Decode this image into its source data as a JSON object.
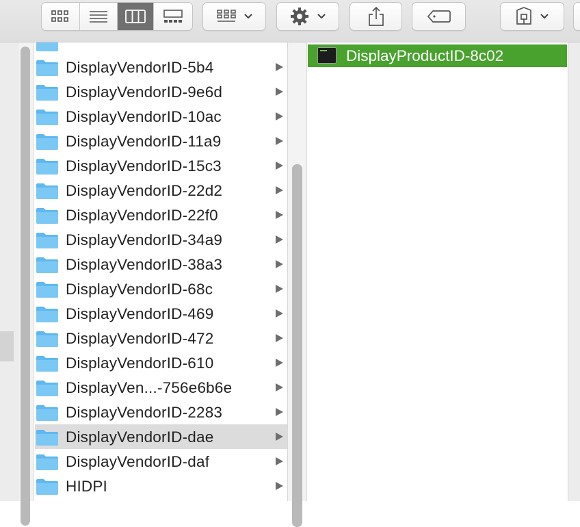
{
  "toolbar": {
    "view_modes": [
      {
        "name": "icon-view",
        "icon": "icon-grid-icon",
        "active": false
      },
      {
        "name": "list-view",
        "icon": "list-lines-icon",
        "active": false
      },
      {
        "name": "column-view",
        "icon": "columns-icon",
        "active": true
      },
      {
        "name": "gallery-view",
        "icon": "gallery-icon",
        "active": false
      }
    ],
    "group_by_icon": "group-grid-icon",
    "action_icon": "gear-icon",
    "share_icon": "share-icon",
    "tags_icon": "tag-icon",
    "dropbox_icon": "dropbox-icon"
  },
  "columns": {
    "folders": [
      {
        "label": "DisplayVendorID-5b4",
        "selected": false
      },
      {
        "label": "DisplayVendorID-9e6d",
        "selected": false
      },
      {
        "label": "DisplayVendorID-10ac",
        "selected": false
      },
      {
        "label": "DisplayVendorID-11a9",
        "selected": false
      },
      {
        "label": "DisplayVendorID-15c3",
        "selected": false
      },
      {
        "label": "DisplayVendorID-22d2",
        "selected": false
      },
      {
        "label": "DisplayVendorID-22f0",
        "selected": false
      },
      {
        "label": "DisplayVendorID-34a9",
        "selected": false
      },
      {
        "label": "DisplayVendorID-38a3",
        "selected": false
      },
      {
        "label": "DisplayVendorID-68c",
        "selected": false
      },
      {
        "label": "DisplayVendorID-469",
        "selected": false
      },
      {
        "label": "DisplayVendorID-472",
        "selected": false
      },
      {
        "label": "DisplayVendorID-610",
        "selected": false
      },
      {
        "label": "DisplayVen...-756e6b6e",
        "selected": false
      },
      {
        "label": "DisplayVendorID-2283",
        "selected": false
      },
      {
        "label": "DisplayVendorID-dae",
        "selected": true
      },
      {
        "label": "DisplayVendorID-daf",
        "selected": false
      },
      {
        "label": "HIDPI",
        "selected": false
      }
    ],
    "product": {
      "label": "DisplayProductID-8c02",
      "selected": true
    }
  },
  "colors": {
    "selection_green": "#49a22e",
    "folder_blue": "#5fb8f0",
    "row_selected_gray": "#dcdcdc"
  }
}
